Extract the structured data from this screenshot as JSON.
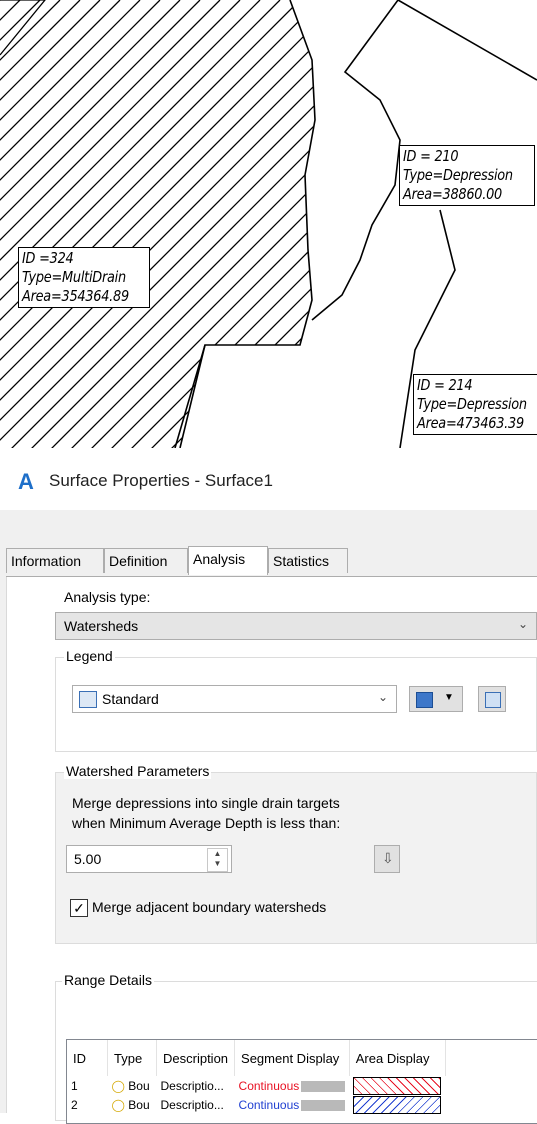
{
  "drawing": {
    "labels": [
      {
        "lines": [
          "ID = 210",
          "Type=Depression",
          "Area=38860.00"
        ]
      },
      {
        "lines": [
          "ID =324",
          "Type=MultiDrain",
          "Area=354364.89"
        ]
      },
      {
        "lines": [
          "ID = 214",
          "Type=Depression",
          "Area=473463.39"
        ]
      }
    ]
  },
  "dialog": {
    "title": "Surface Properties - Surface1",
    "tabs": [
      "Information",
      "Definition",
      "Analysis",
      "Statistics"
    ],
    "active_tab": "Analysis",
    "analysis_type_label": "Analysis type:",
    "analysis_type_value": "Watersheds",
    "legend": {
      "title": "Legend",
      "value": "Standard"
    },
    "watershed_params": {
      "title": "Watershed Parameters",
      "description_line1": "Merge depressions into single drain targets",
      "description_line2": "when Minimum Average Depth is less than:",
      "depth_value": "5.00",
      "merge_checkbox_label": "Merge adjacent boundary watersheds",
      "merge_checked": true
    },
    "range_details": {
      "title": "Range Details",
      "columns": [
        "ID",
        "Type",
        "Description",
        "Segment Display",
        "Area Display"
      ],
      "rows": [
        {
          "id": "1",
          "type": "Bou",
          "description": "Descriptio...",
          "segment": "Continuous",
          "segment_color": "#e81123",
          "hatch_color": "#e81123"
        },
        {
          "id": "2",
          "type": "Bou",
          "description": "Descriptio...",
          "segment": "Continuous",
          "segment_color": "#1f3fd1",
          "hatch_color": "#1f3fd1"
        }
      ]
    }
  }
}
